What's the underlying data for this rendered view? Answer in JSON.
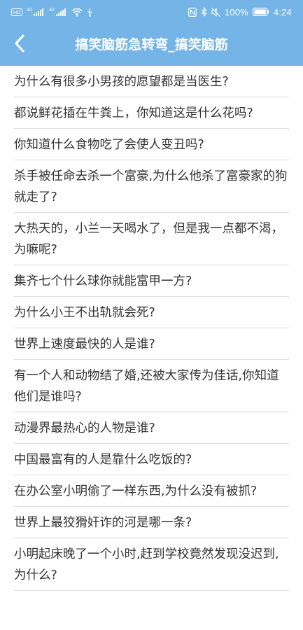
{
  "status_bar": {
    "left_labels": [
      "HD",
      "4G",
      "4G"
    ],
    "battery": "100%",
    "time": "4:24"
  },
  "app_bar": {
    "back_icon": "chevron-left-icon",
    "title": "搞笑脑筋急转弯_搞笑脑筋"
  },
  "colors": {
    "accent": "#74b4e6",
    "text": "#333333",
    "divider": "#dcdcdc"
  },
  "questions": [
    "为什么有很多小男孩的愿望都是当医生?",
    "都说鲜花插在牛粪上，你知道这是什么花吗?",
    "你知道什么食物吃了会使人变丑吗?",
    "杀手被任命去杀一个富豪,为什么他杀了富豪家的狗就走了?",
    "大热天的，小兰一天喝水了，但是我一点都不渴，为嘛呢?",
    "集齐七个什么球你就能富甲一方?",
    "为什么小王不出轨就会死?",
    "世界上速度最快的人是谁?",
    "有一个人和动物结了婚,还被大家传为佳话,你知道他们是谁吗?",
    "动漫界最热心的人物是谁?",
    "中国最富有的人是靠什么吃饭的?",
    "在办公室小明偷了一样东西,为什么没有被抓?",
    "世界上最狡猾奸诈的河是哪一条?",
    "小明起床晚了一个小时,赶到学校竟然发现没迟到,为什么?"
  ]
}
